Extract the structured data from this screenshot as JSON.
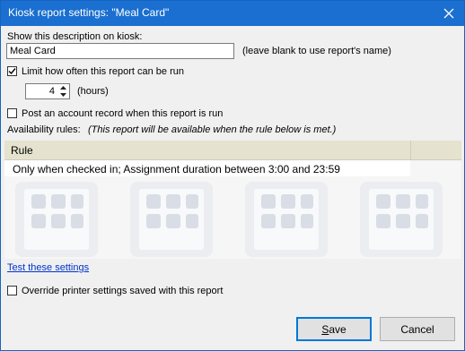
{
  "window": {
    "title": "Kiosk report settings: \"Meal Card\""
  },
  "description": {
    "label": "Show this description on kiosk:",
    "value": "Meal Card",
    "hint": "(leave blank to use report's name)"
  },
  "limit": {
    "checked": true,
    "label": "Limit how often this report can be run",
    "hours_value": "4",
    "hours_label": "(hours)"
  },
  "post_account": {
    "checked": false,
    "label": "Post an account record when this report is run"
  },
  "availability": {
    "label": "Availability rules:",
    "note": "(This report will be available when the rule below is met.)",
    "column_header": "Rule",
    "rows": [
      "Only when checked in; Assignment duration between 3:00 and 23:59"
    ]
  },
  "test_link": "Test these settings",
  "override": {
    "checked": false,
    "label": "Override printer settings saved with this report"
  },
  "buttons": {
    "save_first": "S",
    "save_rest": "ave",
    "cancel": "Cancel"
  },
  "colors": {
    "titlebar": "#1a6fd0",
    "rules_header": "#e5e3cf",
    "link": "#0033cc",
    "default_button_border": "#0078d7"
  }
}
